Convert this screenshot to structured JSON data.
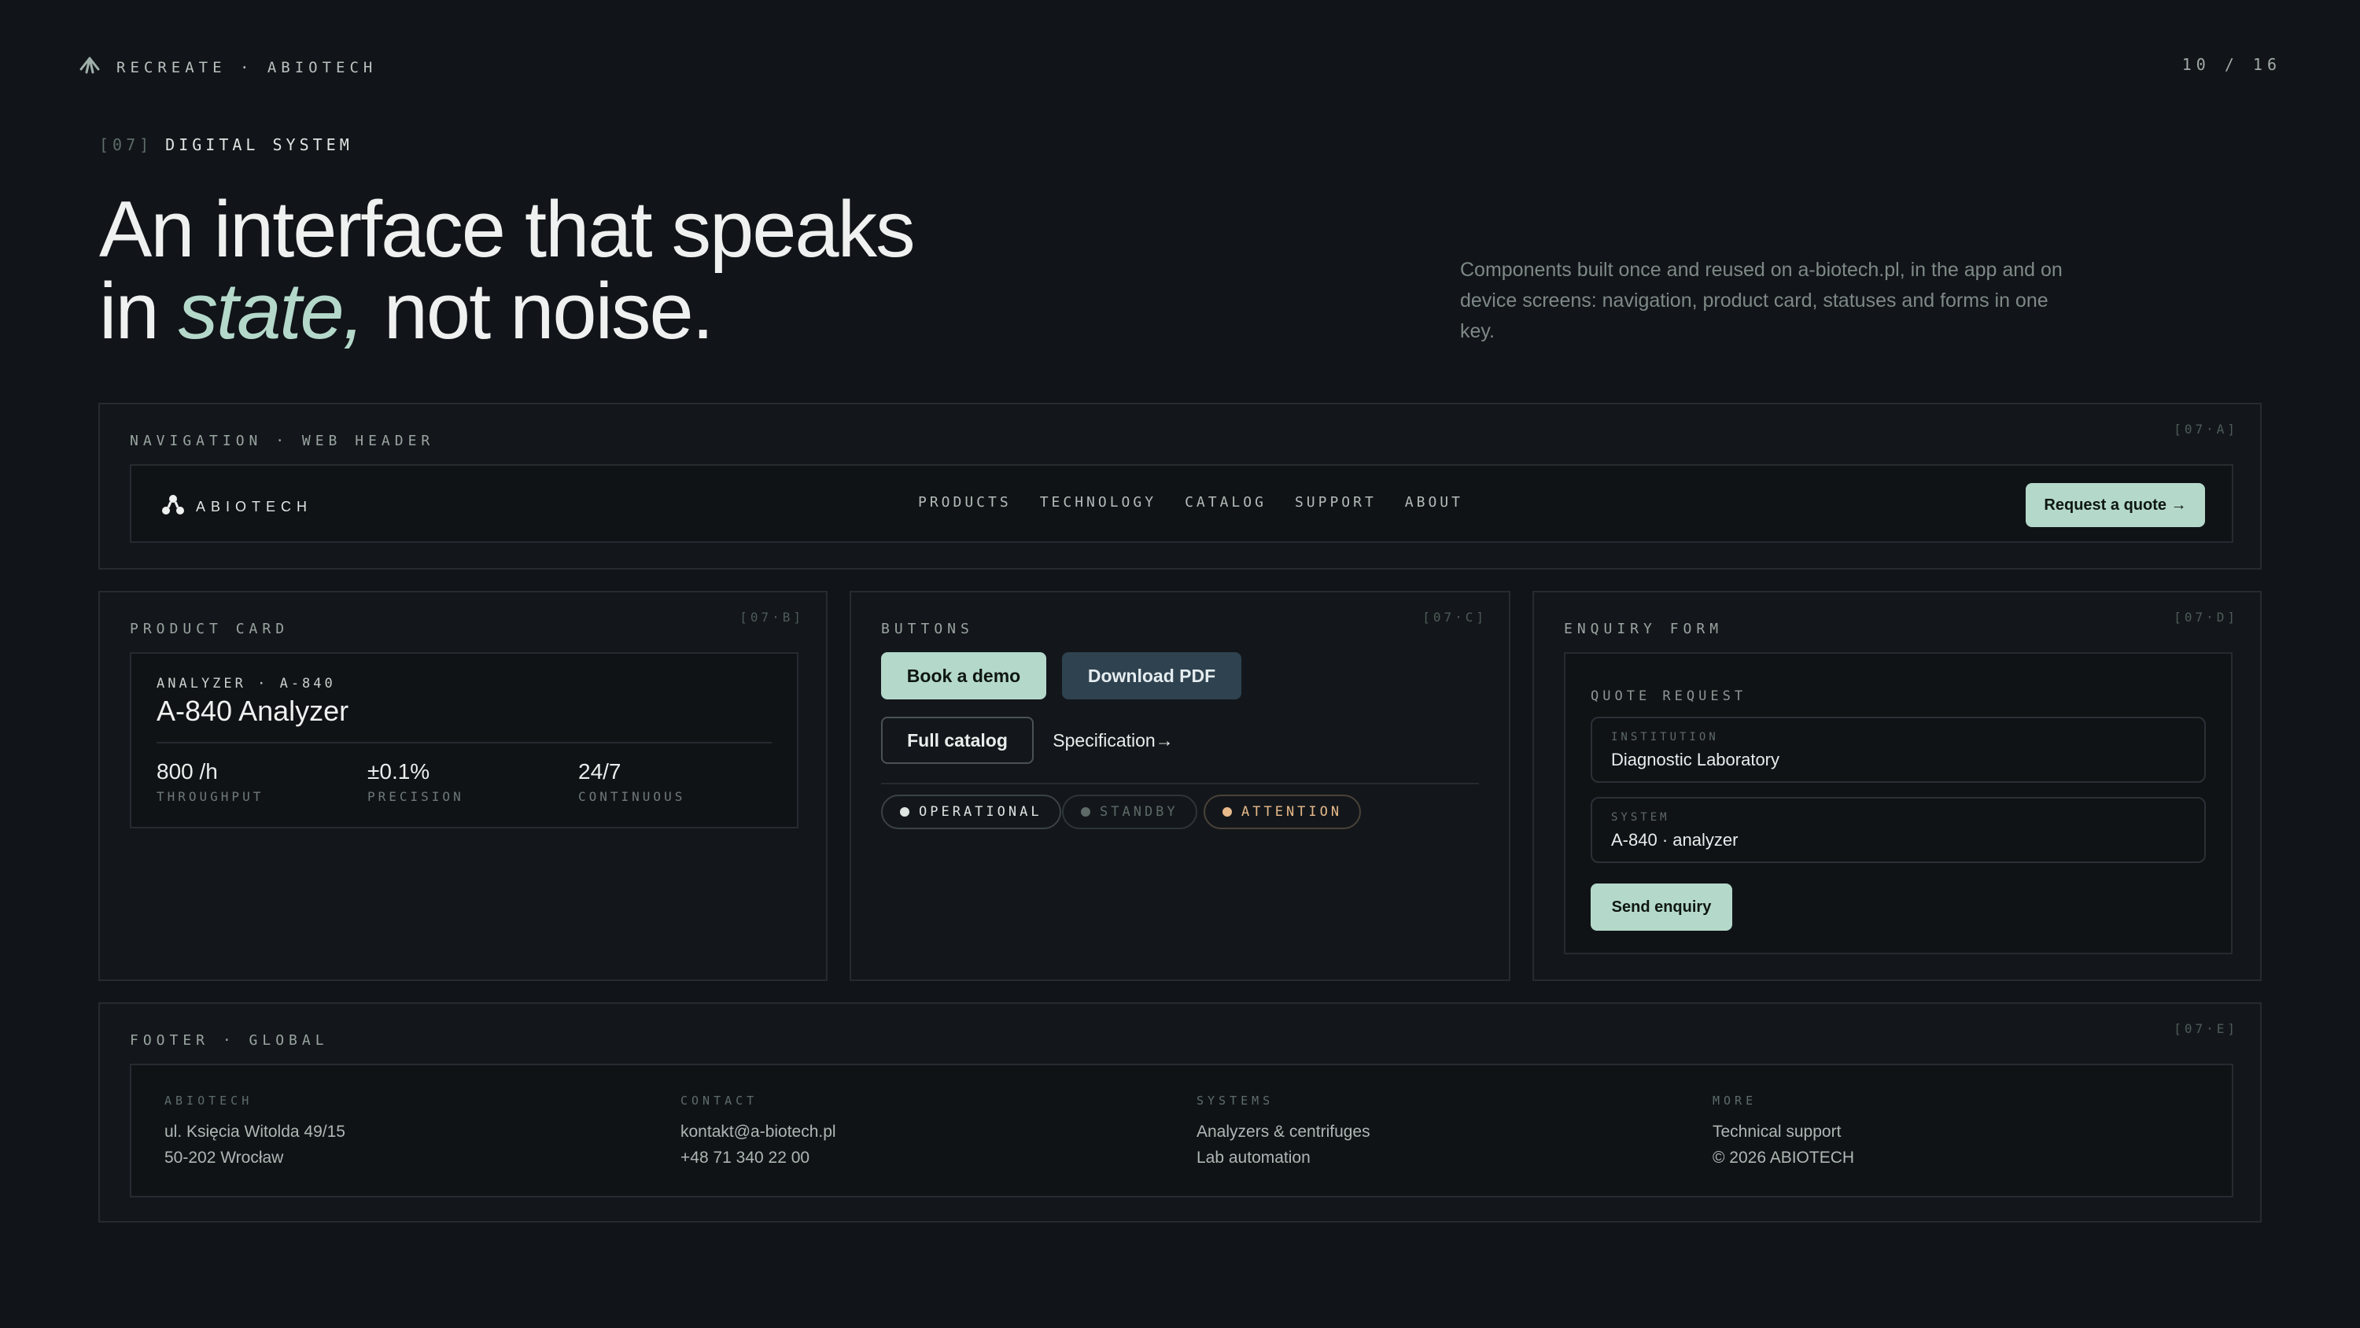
{
  "top": {
    "brand_label": "RECREATE · ABIOTECH",
    "page_number": "10 / 16"
  },
  "section": {
    "number": "[07]",
    "title": "DIGITAL SYSTEM"
  },
  "hero": {
    "line1": "An interface that speaks",
    "line2_prefix": "in ",
    "line2_accent": "state,",
    "line2_suffix": " not noise."
  },
  "lead": "Components built once and reused on a-biotech.pl, in the app and on device screens: navigation, product card, statuses and forms in one key.",
  "navigation": {
    "title": "NAVIGATION · WEB HEADER",
    "code": "[07·A]",
    "logo_text": "ABIOTECH",
    "links": [
      "PRODUCTS",
      "TECHNOLOGY",
      "CATALOG",
      "SUPPORT",
      "ABOUT"
    ],
    "cta": "Request a quote →"
  },
  "product_card": {
    "title": "PRODUCT CARD",
    "code": "[07·B]",
    "kicker": "ANALYZER · A-840",
    "name": "A-840 Analyzer",
    "specs": [
      {
        "value": "800 /h",
        "label": "THROUGHPUT"
      },
      {
        "value": "±0.1%",
        "label": "PRECISION"
      },
      {
        "value": "24/7",
        "label": "CONTINUOUS"
      }
    ]
  },
  "buttons": {
    "title": "BUTTONS",
    "code": "[07·C]",
    "primary": "Book a demo",
    "secondary": "Download PDF",
    "outline": "Full catalog",
    "link": "Specification→",
    "statuses": [
      {
        "label": "OPERATIONAL",
        "color": "#dfe5e2"
      },
      {
        "label": "STANDBY",
        "color": "#5d6a67"
      },
      {
        "label": "ATTENTION",
        "color": "#e8b98a"
      }
    ]
  },
  "enquiry": {
    "title": "ENQUIRY FORM",
    "code": "[07·D]",
    "form_title": "QUOTE REQUEST",
    "fields": [
      {
        "label": "INSTITUTION",
        "value": "Diagnostic Laboratory"
      },
      {
        "label": "SYSTEM",
        "value": "A-840 · analyzer"
      }
    ],
    "submit": "Send enquiry"
  },
  "footer": {
    "title": "FOOTER · GLOBAL",
    "code": "[07·E]",
    "columns": [
      {
        "title": "ABIOTECH",
        "lines": [
          "ul. Księcia Witolda 49/15",
          "50-202 Wrocław"
        ]
      },
      {
        "title": "CONTACT",
        "lines": [
          "kontakt@a-biotech.pl",
          "+48 71 340 22 00"
        ]
      },
      {
        "title": "SYSTEMS",
        "lines": [
          "Analyzers & centrifuges",
          "Lab automation"
        ]
      },
      {
        "title": "MORE",
        "lines": [
          "Technical support",
          "© 2026 ABIOTECH"
        ]
      }
    ]
  },
  "colors": {
    "background": "#111418",
    "accent": "#b4d9cb",
    "secondary_button": "#2f4250",
    "attention": "#e8b98a"
  }
}
